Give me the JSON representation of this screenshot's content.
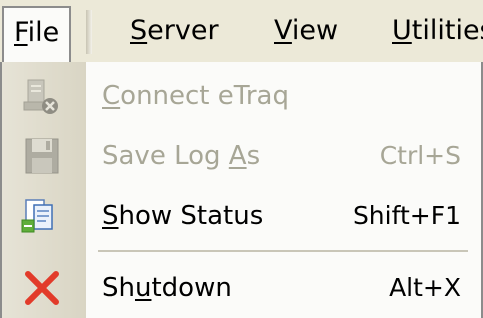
{
  "menubar": {
    "items": [
      {
        "label": "File",
        "mnemonic_index": 0,
        "active": true
      },
      {
        "label": "Server",
        "mnemonic_index": 0
      },
      {
        "label": "View",
        "mnemonic_index": 0
      },
      {
        "label": "Utilities",
        "mnemonic_index": 0
      }
    ]
  },
  "file_menu": {
    "items": [
      {
        "label": "Connect eTraq",
        "mnemonic_index": 0,
        "shortcut": "",
        "icon": "connect-etraq-icon",
        "enabled": false
      },
      {
        "label": "Save Log As",
        "mnemonic_index": 9,
        "shortcut": "Ctrl+S",
        "icon": "save-floppy-icon",
        "enabled": false
      },
      {
        "label": "Show Status",
        "mnemonic_index": 0,
        "shortcut": "Shift+F1",
        "icon": "status-documents-icon",
        "enabled": true
      },
      {
        "label": "Shutdown",
        "mnemonic_index": 2,
        "shortcut": "Alt+X",
        "icon": "close-x-icon",
        "enabled": true
      }
    ]
  },
  "colors": {
    "menu_background": "#fbfbf9",
    "gutter": "#dedbcb",
    "disabled_text": "#a7a696",
    "shutdown_icon": "#e23b2a"
  }
}
